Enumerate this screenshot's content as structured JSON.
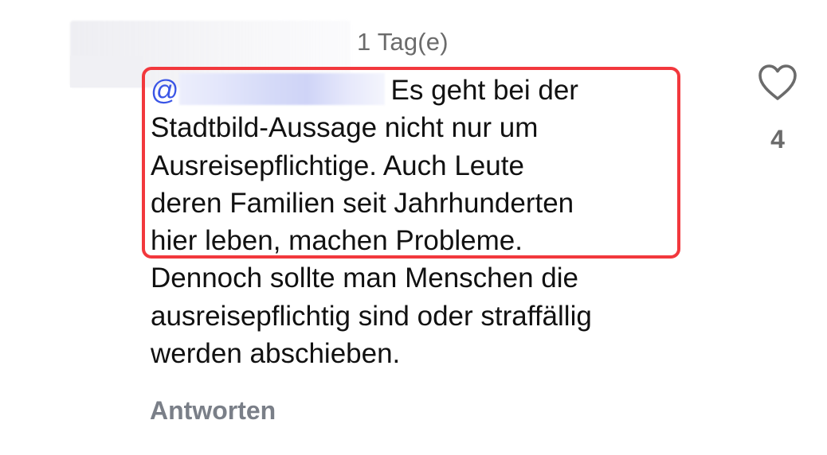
{
  "comment": {
    "timestamp": "1 Tag(e)",
    "mention_prefix": "@",
    "text_first_line_rest": "Es geht bei der",
    "text_highlighted_lines": [
      "Stadtbild-Aussage nicht nur um",
      "Ausreisepflichtige. Auch Leute",
      "deren Familien seit Jahrhunderten",
      "hier leben, machen Probleme."
    ],
    "text_rest_lines": [
      "Dennoch sollte man Menschen die",
      "ausreisepflichtig sind oder straffällig",
      "werden abschieben."
    ],
    "like_count": "4",
    "reply_label": "Antworten"
  },
  "icons": {
    "like": "heart-outline-icon"
  },
  "colors": {
    "mention": "#3a55e6",
    "highlight_border": "#f2383d",
    "muted_text": "#6b6b6b",
    "reply_text": "#7a7f88"
  }
}
